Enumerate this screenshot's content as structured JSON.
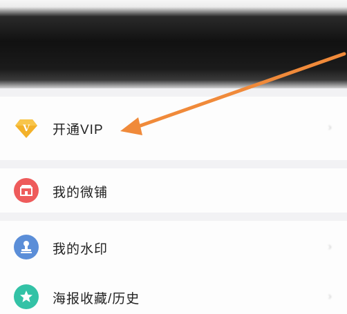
{
  "header": {
    "username": "",
    "subtitle": ""
  },
  "menu": {
    "vip": {
      "label": "开通VIP",
      "icon": "diamond-v-icon",
      "icon_color": "#f2a91b",
      "hint": ""
    },
    "shop": {
      "label": "我的微铺",
      "icon": "shop-icon",
      "icon_color": "#ee5b5b"
    },
    "watermark": {
      "label": "我的水印",
      "icon": "stamp-icon",
      "icon_color": "#5b8ed8",
      "hint": ""
    },
    "poster": {
      "label": "海报收藏/历史",
      "icon": "star-icon",
      "icon_color": "#33c2a6"
    }
  },
  "annotation": {
    "arrow_color": "#f08a3a"
  }
}
